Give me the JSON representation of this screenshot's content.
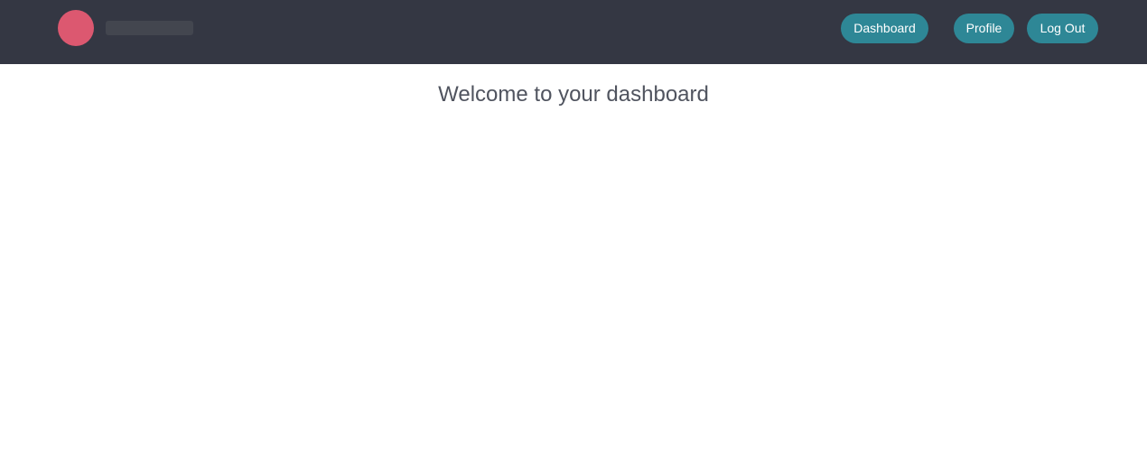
{
  "colors": {
    "navbar_bg": "#343743",
    "logo": "#dc5870",
    "brand_placeholder": "#43464f",
    "button_bg": "#2e8796",
    "title_text": "#50545f"
  },
  "header": {
    "logo_icon": "circle-logo-icon",
    "nav": {
      "dashboard_label": "Dashboard",
      "profile_label": "Profile",
      "logout_label": "Log Out"
    }
  },
  "main": {
    "title": "Welcome to your dashboard"
  }
}
